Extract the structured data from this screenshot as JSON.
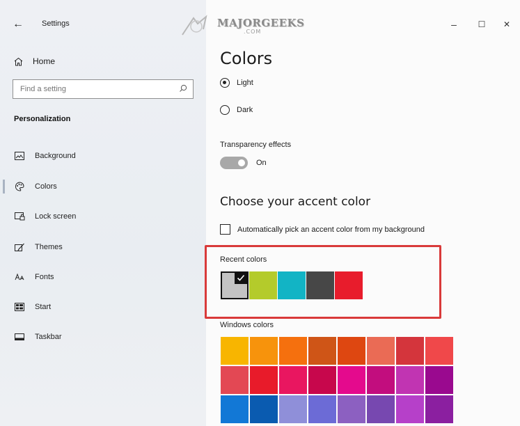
{
  "window": {
    "title": "Settings",
    "minimize_glyph": "–",
    "maximize_glyph": "☐",
    "close_glyph": "✕",
    "back_glyph": "←"
  },
  "watermark": {
    "name": "MAJORGEEKS",
    "domain": ".COM"
  },
  "sidebar": {
    "home_label": "Home",
    "search_placeholder": "Find a setting",
    "section_title": "Personalization",
    "items": [
      {
        "label": "Background",
        "icon": "picture-icon"
      },
      {
        "label": "Colors",
        "icon": "palette-icon",
        "active": true
      },
      {
        "label": "Lock screen",
        "icon": "lock-screen-icon"
      },
      {
        "label": "Themes",
        "icon": "brush-icon"
      },
      {
        "label": "Fonts",
        "icon": "font-icon"
      },
      {
        "label": "Start",
        "icon": "start-icon"
      },
      {
        "label": "Taskbar",
        "icon": "taskbar-icon"
      }
    ]
  },
  "main": {
    "heading": "Colors",
    "mode_options": [
      {
        "label": "Light",
        "selected": true
      },
      {
        "label": "Dark",
        "selected": false
      }
    ],
    "transparency_label": "Transparency effects",
    "transparency_state": "On",
    "accent_heading": "Choose your accent color",
    "auto_pick_label": "Automatically pick an accent color from my background",
    "auto_pick_checked": false,
    "recent_label": "Recent colors",
    "recent_colors": [
      "#c3c3c3",
      "#b4cb2b",
      "#12b4c5",
      "#474747",
      "#e81c2c"
    ],
    "recent_selected_index": 0,
    "windows_label": "Windows colors",
    "windows_colors": [
      "#f8b500",
      "#f7930c",
      "#f5700e",
      "#cf5517",
      "#de4711",
      "#ea6b55",
      "#d4353c",
      "#f0484a",
      "#e34854",
      "#e81b2a",
      "#e91660",
      "#c7074c",
      "#e40a8d",
      "#c20d7e",
      "#c134b2",
      "#9a098f",
      "#1278d6",
      "#0a5bb0",
      "#8f8fd9",
      "#6c6bd6",
      "#8c60c1",
      "#7748b0",
      "#b640c9",
      "#8b1fa0"
    ],
    "highlight_color": "#d93a3a"
  }
}
